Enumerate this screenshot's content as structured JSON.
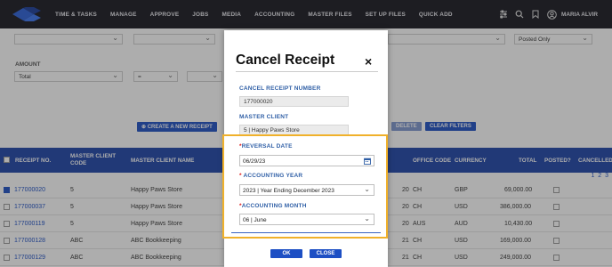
{
  "nav": {
    "items": [
      "TIME & TASKS",
      "MANAGE",
      "APPROVE",
      "JOBS",
      "MEDIA",
      "ACCOUNTING",
      "MASTER FILES",
      "SET UP FILES",
      "QUICK ADD"
    ],
    "user": "MARIA ALVIR"
  },
  "filters": {
    "posted_value": "Posted Only",
    "amount_label": "AMOUNT",
    "amount_type": "Total",
    "operator": "="
  },
  "buttons": {
    "create_receipt": "CREATE A NEW RECEIPT",
    "delete": "DELETE",
    "clear_filters": "CLEAR FILTERS"
  },
  "table": {
    "headers": {
      "receipt_no": "RECEIPT NO.",
      "master_client_code": "MASTER CLIENT CODE",
      "master_client_name": "MASTER CLIENT NAME",
      "office_code": "OFFICE CODE",
      "currency": "CURRENCY",
      "total": "TOTAL",
      "posted": "POSTED?",
      "cancelled": "CANCELLED"
    },
    "pages": [
      "1",
      "2",
      "3"
    ],
    "rows": [
      {
        "receipt": "177000020",
        "code": "5",
        "name": "Happy Paws Store",
        "date_tail": "20",
        "office": "CH",
        "currency": "GBP",
        "total": "69,000.00"
      },
      {
        "receipt": "177000037",
        "code": "5",
        "name": "Happy Paws Store",
        "date_tail": "20",
        "office": "CH",
        "currency": "USD",
        "total": "386,000.00"
      },
      {
        "receipt": "177000119",
        "code": "5",
        "name": "Happy Paws Store",
        "date_tail": "20",
        "office": "AUS",
        "currency": "AUD",
        "total": "10,430.00"
      },
      {
        "receipt": "177000128",
        "code": "ABC",
        "name": "ABC Bookkeeping",
        "date_tail": "21",
        "office": "CH",
        "currency": "USD",
        "total": "169,000.00"
      },
      {
        "receipt": "177000129",
        "code": "ABC",
        "name": "ABC Bookkeeping",
        "date_tail": "21",
        "office": "CH",
        "currency": "USD",
        "total": "249,000.00"
      }
    ]
  },
  "modal": {
    "title": "Cancel Receipt",
    "close": "×",
    "cancel_receipt_number_label": "CANCEL RECEIPT NUMBER",
    "cancel_receipt_number": "177000020",
    "master_client_label": "MASTER CLIENT",
    "master_client": "5 | Happy Paws Store",
    "reversal_date_label": "REVERSAL DATE",
    "reversal_date": "06/29/23",
    "accounting_year_label": "ACCOUNTING YEAR",
    "accounting_year": "2023 | Year Ending December 2023",
    "accounting_month_label": "ACCOUNTING MONTH",
    "accounting_month": "06 | June",
    "ok": "OK",
    "close_button": "CLOSE",
    "required_mark": "*"
  },
  "colors": {
    "nav_bg": "#17171f",
    "table_header": "#1e44a8",
    "button_blue": "#1d4fc4",
    "label_blue": "#2f5fa6",
    "highlight": "#f0b12b"
  }
}
